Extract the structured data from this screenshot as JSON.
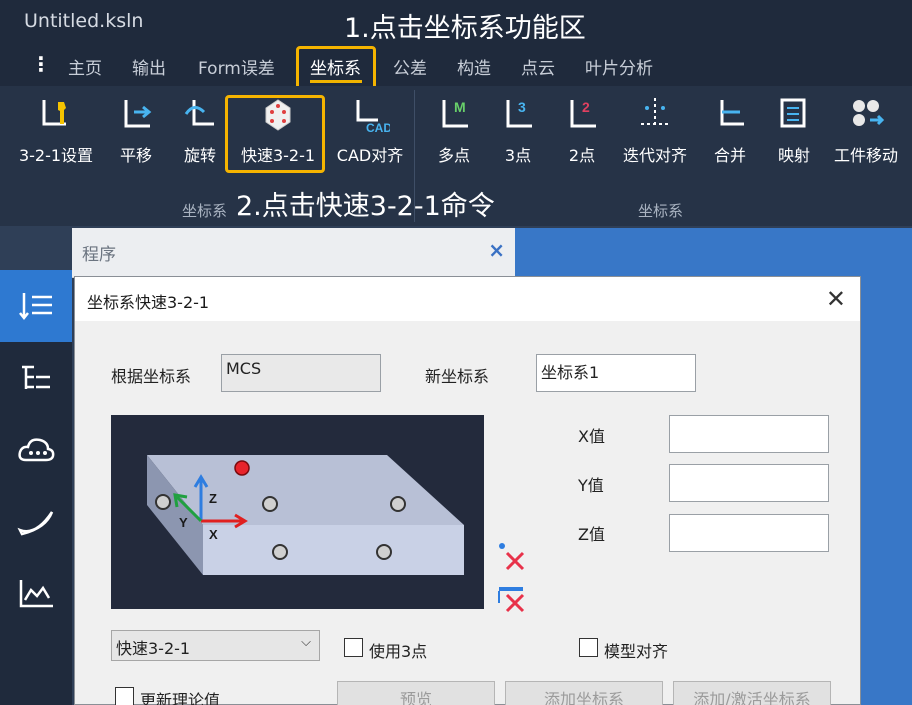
{
  "window": {
    "title": "Untitled.ksln"
  },
  "annotations": {
    "step1": "1.点击坐标系功能区",
    "step2": "2.点击快速3-2-1命令"
  },
  "menu": {
    "items": [
      "主页",
      "输出",
      "Form误差",
      "坐标系",
      "公差",
      "构造",
      "点云",
      "叶片分析"
    ],
    "active": "坐标系"
  },
  "ribbon": {
    "group1": {
      "label": "坐标系",
      "tools": [
        "3-2-1设置",
        "平移",
        "旋转",
        "快速3-2-1",
        "CAD对齐"
      ]
    },
    "group2": {
      "label": "坐标系",
      "tools": [
        "多点",
        "3点",
        "2点",
        "迭代对齐",
        "合并",
        "映射",
        "工件移动"
      ]
    }
  },
  "program_panel": {
    "title": "程序",
    "close": "×"
  },
  "dialog": {
    "title": "坐标系快速3-2-1",
    "close": "✕",
    "base_label": "根据坐标系",
    "base_value": "MCS",
    "new_label": "新坐标系",
    "new_value": "坐标系1",
    "x_label": "X值",
    "y_label": "Y值",
    "z_label": "Z值",
    "x_value": "",
    "y_value": "",
    "z_value": "",
    "mode_value": "快速3-2-1",
    "use3_label": "使用3点",
    "model_align_label": "模型对齐",
    "update_label": "更新理论值",
    "buttons": [
      "预览",
      "添加坐标系",
      "添加/激活坐标系"
    ]
  },
  "colors": {
    "accent": "#f5b400",
    "ribbon_bg": "#263347",
    "sidebar_active": "#2e79d1"
  }
}
